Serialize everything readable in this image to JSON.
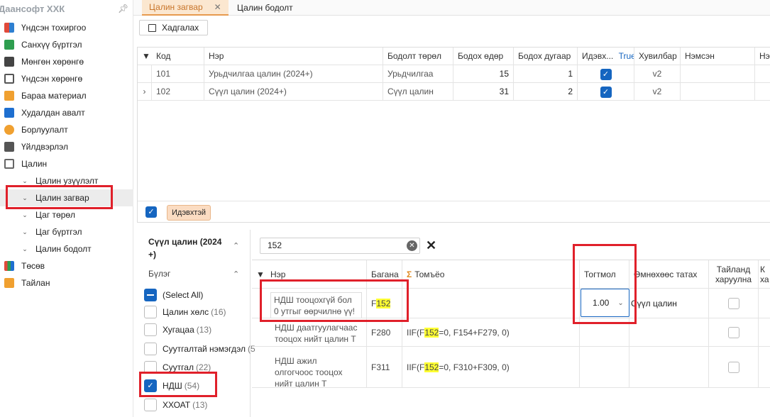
{
  "app": {
    "title": "Даансофт ХХК"
  },
  "sidebar": {
    "items": [
      {
        "label": "Үндсэн тохиргоо",
        "icon": "grid-icon",
        "color": "#e04a3a"
      },
      {
        "label": "Санхүү бүртгэл",
        "icon": "ledger-icon",
        "color": "#2e9e4f"
      },
      {
        "label": "Мөнгөн хөрөнгө",
        "icon": "money-icon",
        "color": "#444444"
      },
      {
        "label": "Үндсэн хөрөнгө",
        "icon": "building-icon",
        "color": "#555555"
      },
      {
        "label": "Бараа материал",
        "icon": "box-icon",
        "color": "#f0a030"
      },
      {
        "label": "Худалдан авалт",
        "icon": "truck-icon",
        "color": "#1e6fd0"
      },
      {
        "label": "Борлуулалт",
        "icon": "cart-icon",
        "color": "#f0a030"
      },
      {
        "label": "Үйлдвэрлэл",
        "icon": "factory-icon",
        "color": "#555555"
      },
      {
        "label": "Цалин",
        "icon": "payroll-icon",
        "color": "#666666"
      }
    ],
    "sub_items": [
      {
        "label": "Цалин узүүлэлт"
      },
      {
        "label": "Цалин загвар"
      },
      {
        "label": "Цаг төрөл"
      },
      {
        "label": "Цаг бүртгэл"
      },
      {
        "label": "Цалин бодолт"
      }
    ],
    "bottom_items": [
      {
        "label": "Төсөв",
        "icon": "bar-chart-icon"
      },
      {
        "label": "Тайлан",
        "icon": "report-icon"
      }
    ]
  },
  "tabs": [
    {
      "label": "Цалин загвар",
      "active": true
    },
    {
      "label": "Цалин бодолт",
      "active": false
    }
  ],
  "toolbar": {
    "save_label": "Хадгалах"
  },
  "grid1": {
    "headers": [
      "Код",
      "Нэр",
      "Бодолт төрөл",
      "Бодох өдөр",
      "Бодох дугаар",
      "Идэвх...",
      "True",
      "Хувилбар",
      "Нэмсэн",
      "Нэ"
    ],
    "rows": [
      {
        "code": "101",
        "name": "Урьдчилгаа цалин (2024+)",
        "type": "Урьдчилгаа",
        "day": "15",
        "number": "1",
        "active": true,
        "version": "v2"
      },
      {
        "code": "102",
        "name": "Сүүл цалин (2024+)",
        "type": "Сүүл цалин",
        "day": "31",
        "number": "2",
        "active": true,
        "version": "v2"
      }
    ],
    "footer_filter": "Идэвхтэй"
  },
  "filter_panel": {
    "title": "Сүүл цалин (2024 +)",
    "group_label": "Бүлэг",
    "items": [
      {
        "label": "(Select All)",
        "count": "",
        "state": "partial"
      },
      {
        "label": "Цалин хөлс",
        "count": "(16)",
        "state": "off"
      },
      {
        "label": "Хугацаа",
        "count": "(13)",
        "state": "off"
      },
      {
        "label": "Суутгалтай нэмэгдэл",
        "count": "(5",
        "state": "off"
      },
      {
        "label": "Суутгал",
        "count": "(22)",
        "state": "off"
      },
      {
        "label": "НДШ",
        "count": "(54)",
        "state": "on"
      },
      {
        "label": "ХХОАТ",
        "count": "(13)",
        "state": "off"
      }
    ]
  },
  "search": {
    "value": "152"
  },
  "grid2": {
    "headers": [
      "Нэр",
      "Багана",
      "Томъёо",
      "Тогтмол",
      "Өмнөхөөс татах",
      "Тайланд харуулна",
      "К ха"
    ],
    "rows": [
      {
        "name": "НДШ тооцохгүй бол 0 утгыг өөрчилнө үү!",
        "col_prefix": "F",
        "col_hl": "152",
        "formula_a": "",
        "formula_hl": "",
        "formula_b": "",
        "constant": "1.00",
        "prev": "Сүүл цалин"
      },
      {
        "name": "НДШ даатгуулагчаас тооцох нийт цалин Т",
        "col_prefix": "F280",
        "col_hl": "",
        "formula_a": "IIF(F",
        "formula_hl": "152",
        "formula_b": "=0, F154+F279, 0)",
        "constant": "",
        "prev": ""
      },
      {
        "name": "НДШ ажил олгогчоос тооцох нийт цалин Т",
        "col_prefix": "F311",
        "col_hl": "",
        "formula_a": "IIF(F",
        "formula_hl": "152",
        "formula_b": "=0, F310+F309, 0)",
        "constant": "",
        "prev": ""
      }
    ]
  },
  "colors": {
    "accent": "#1565c0",
    "tab_active_bg": "#fbe7d0",
    "highlight_red": "#e0202a",
    "search_highlight": "#ffff33"
  }
}
